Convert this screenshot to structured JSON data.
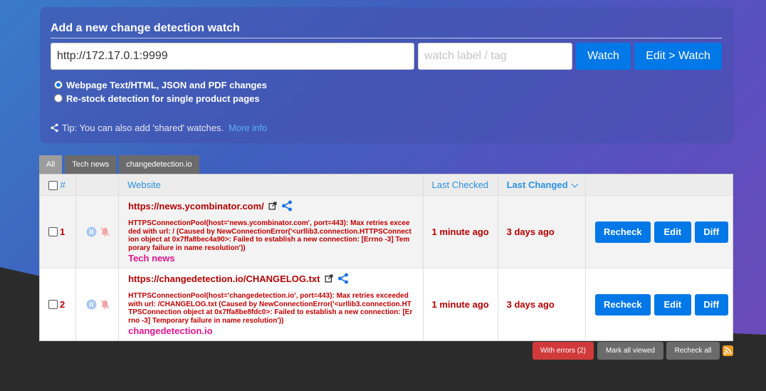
{
  "add_watch": {
    "title": "Add a new change detection watch",
    "url_value": "http://172.17.0.1:9999",
    "tag_placeholder": "watch label / tag",
    "watch_button": "Watch",
    "edit_watch_button": "Edit > Watch",
    "options": [
      {
        "label": "Webpage Text/HTML, JSON and PDF changes",
        "checked": true
      },
      {
        "label": "Re-stock detection for single product pages",
        "checked": false
      }
    ],
    "tip_text": "Tip: You can also add 'shared' watches.",
    "tip_link": "More info"
  },
  "tabs": [
    "All",
    "Tech news",
    "changedetection.io"
  ],
  "table": {
    "headers": {
      "number": "#",
      "website": "Website",
      "last_checked": "Last Checked",
      "last_changed": "Last Changed"
    },
    "rows": [
      {
        "number": "1",
        "url": "https://news.ycombinator.com/",
        "error": "HTTPSConnectionPool(host='news.ycombinator.com', port=443): Max retries exceeded with url: / (Caused by NewConnectionError('<urllib3.connection.HTTPSConnection object at 0x7ffa8bec4a90>: Failed to establish a new connection: [Errno -3] Temporary failure in name resolution'))",
        "tag": "Tech news",
        "last_checked": "1 minute ago",
        "last_changed": "3 days ago"
      },
      {
        "number": "2",
        "url": "https://changedetection.io/CHANGELOG.txt",
        "error": "HTTPSConnectionPool(host='changedetection.io', port=443): Max retries exceeded with url: /CHANGELOG.txt (Caused by NewConnectionError('<urllib3.connection.HTTPSConnection object at 0x7ffa8be8fdc0>: Failed to establish a new connection: [Errno -3] Temporary failure in name resolution'))",
        "tag": "changedetection.io",
        "last_checked": "1 minute ago",
        "last_changed": "3 days ago"
      }
    ],
    "row_actions": {
      "recheck": "Recheck",
      "edit": "Edit",
      "diff": "Diff"
    }
  },
  "footer": {
    "with_errors": "With errors (2)",
    "mark_all_viewed": "Mark all viewed",
    "recheck_all": "Recheck all"
  },
  "colors": {
    "primary_blue": "#0078e7",
    "error_red": "#c00000",
    "tag_pink": "#e0168e",
    "errors_button": "#d13a3a"
  }
}
